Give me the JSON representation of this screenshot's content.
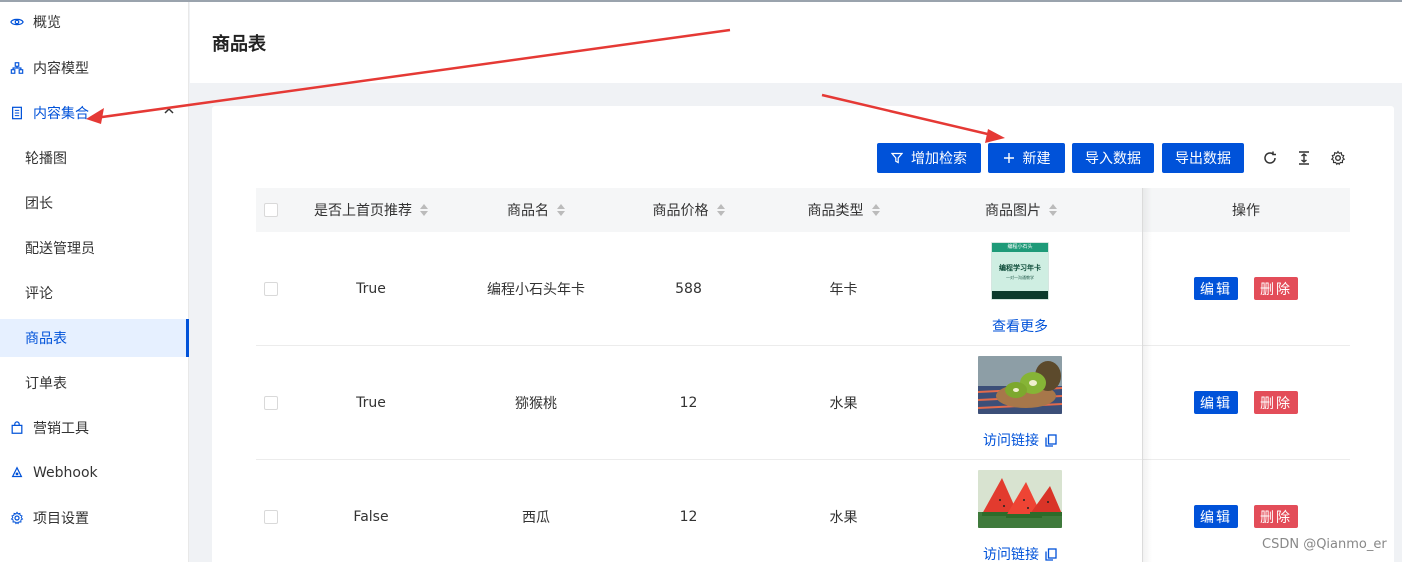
{
  "sidebar": {
    "items": [
      {
        "label": "概览",
        "icon": "eye-icon"
      },
      {
        "label": "内容模型",
        "icon": "hierarchy-icon"
      },
      {
        "label": "内容集合",
        "icon": "document-icon"
      },
      {
        "label": "营销工具",
        "icon": "bag-icon"
      },
      {
        "label": "Webhook",
        "icon": "webhook-icon"
      },
      {
        "label": "项目设置",
        "icon": "gear-icon"
      }
    ],
    "sub_items": [
      {
        "label": "轮播图"
      },
      {
        "label": "团长"
      },
      {
        "label": "配送管理员"
      },
      {
        "label": "评论"
      },
      {
        "label": "商品表"
      },
      {
        "label": "订单表"
      }
    ]
  },
  "header": {
    "title": "商品表"
  },
  "toolbar": {
    "add_filter": "增加检索",
    "new": "新建",
    "import": "导入数据",
    "export": "导出数据"
  },
  "table": {
    "columns": [
      "是否上首页推荐",
      "商品名",
      "商品价格",
      "商品类型",
      "商品图片",
      "操作"
    ],
    "rows": [
      {
        "recommend": "True",
        "name": "编程小石头年卡",
        "price": "588",
        "type": "年卡",
        "image_link": "查看更多",
        "image_title": "编程学习年卡",
        "image_sub": "一对一沟通教学",
        "image_top": "编程小石头"
      },
      {
        "recommend": "True",
        "name": "猕猴桃",
        "price": "12",
        "type": "水果",
        "image_link": "访问链接"
      },
      {
        "recommend": "False",
        "name": "西瓜",
        "price": "12",
        "type": "水果",
        "image_link": "访问链接"
      }
    ],
    "edit_label": "编辑",
    "delete_label": "删除"
  },
  "watermark": "CSDN @Qianmo_er",
  "colors": {
    "primary": "#0052d9",
    "danger": "#e34d59",
    "annotation": "#e53935"
  }
}
